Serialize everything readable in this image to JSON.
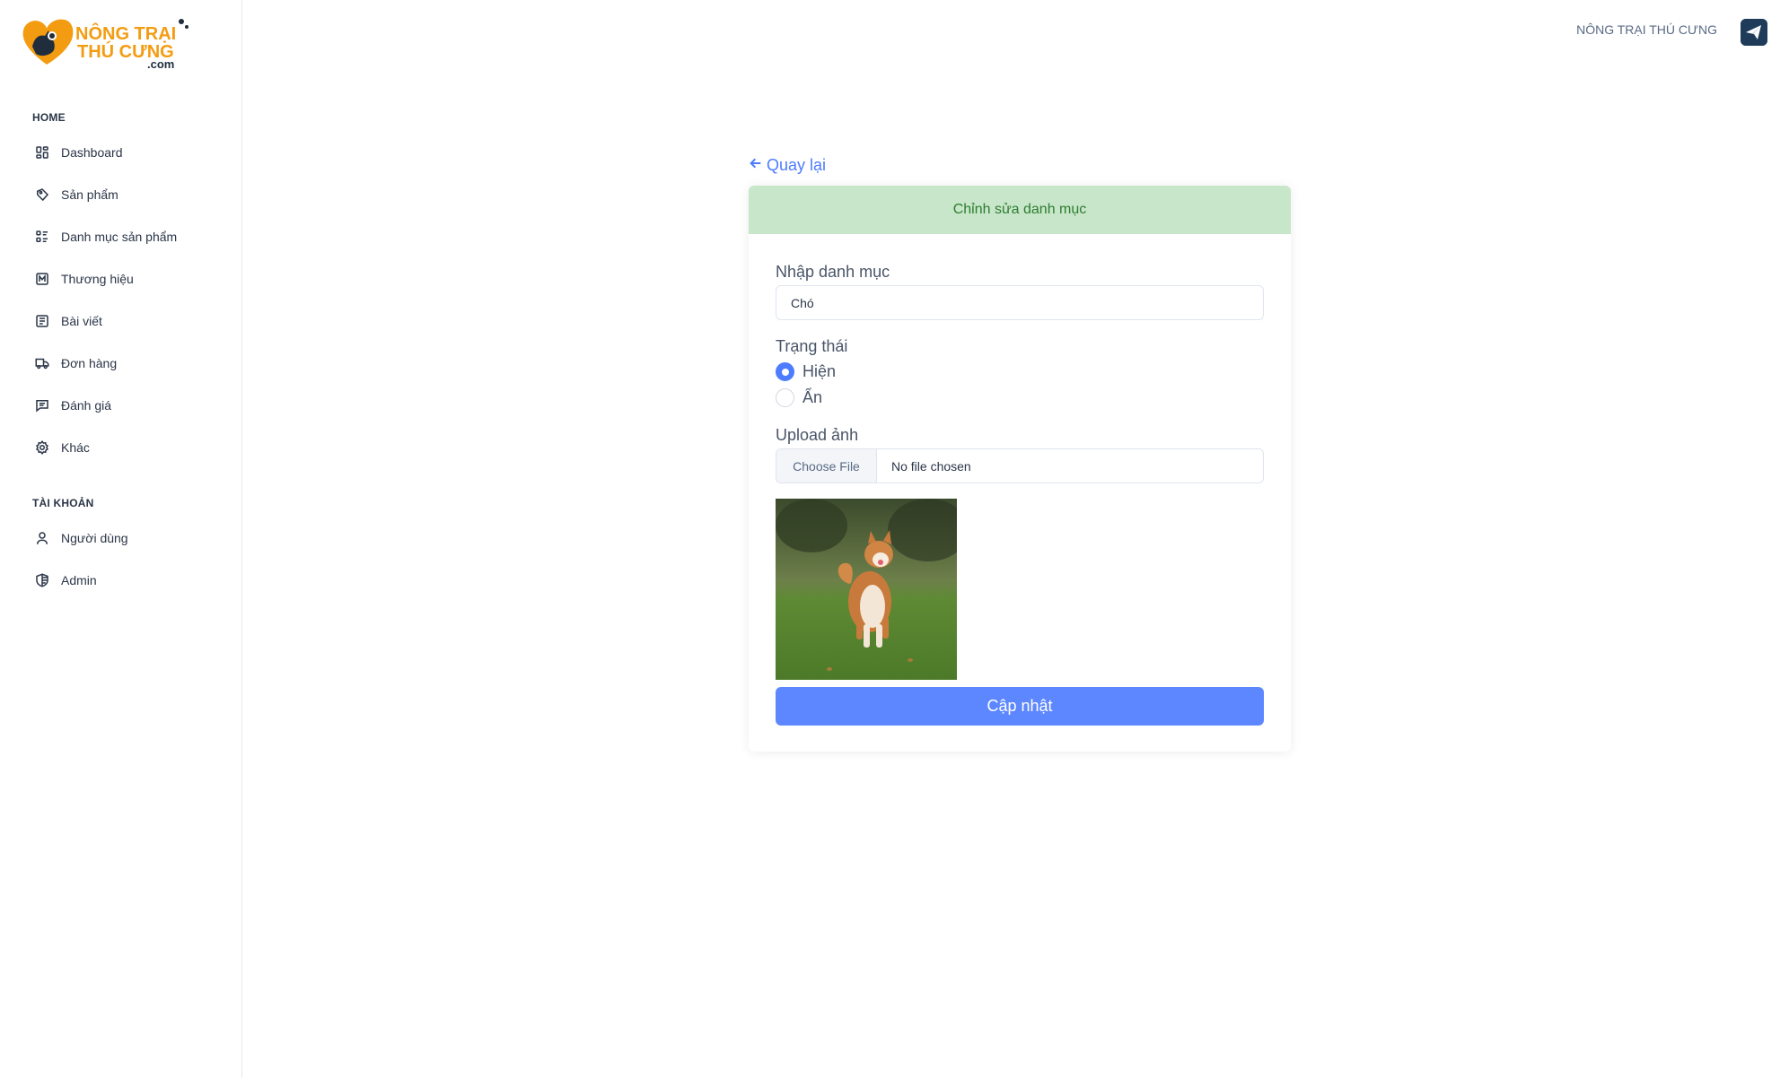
{
  "brand": {
    "logo_line1": "NÔNG TRẠI",
    "logo_line2": "THÚ CƯNG",
    "logo_line3": ".com",
    "header_name": "NÔNG TRẠI THÚ CƯNG"
  },
  "sidebar": {
    "home_title": "HOME",
    "home_items": [
      {
        "label": "Dashboard",
        "icon": "dashboard-icon"
      },
      {
        "label": "Sản phẩm",
        "icon": "product-tag-icon"
      },
      {
        "label": "Danh mục sản phẩm",
        "icon": "list-details-icon"
      },
      {
        "label": "Thương hiệu",
        "icon": "brand-icon"
      },
      {
        "label": "Bài viết",
        "icon": "article-icon"
      },
      {
        "label": "Đơn hàng",
        "icon": "truck-delivery-icon"
      },
      {
        "label": "Đánh giá",
        "icon": "message-icon"
      },
      {
        "label": "Khác",
        "icon": "settings-icon"
      }
    ],
    "account_title": "TÀI KHOẢN",
    "account_items": [
      {
        "label": "Người dùng",
        "icon": "user-icon"
      },
      {
        "label": "Admin",
        "icon": "shield-icon"
      }
    ]
  },
  "main": {
    "back_label": "Quay lại",
    "card_title": "Chỉnh sửa danh mục",
    "category_label": "Nhập danh mục",
    "category_value": "Chó",
    "status_label": "Trạng thái",
    "status_options": [
      {
        "label": "Hiện",
        "checked": true
      },
      {
        "label": "Ẩn",
        "checked": false
      }
    ],
    "upload_label": "Upload ảnh",
    "choose_file_label": "Choose File",
    "file_status": "No file chosen",
    "submit_label": "Cập nhật"
  },
  "colors": {
    "accent": "#5d87ff",
    "card_header_bg": "#c8e6c9",
    "card_header_text": "#2e7d32",
    "logo_orange": "#f39c12"
  }
}
